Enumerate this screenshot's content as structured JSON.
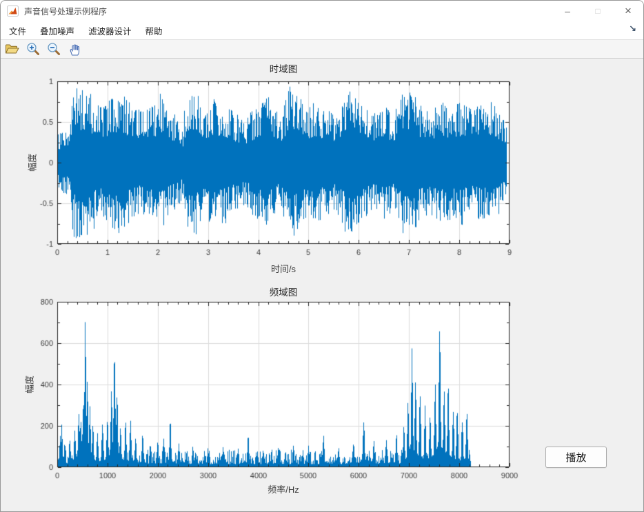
{
  "window": {
    "title": "声音信号处理示例程序",
    "controls": {
      "minimize": "–",
      "maximize": "□",
      "close": "×"
    }
  },
  "menu_bar": {
    "items": [
      {
        "label": "文件"
      },
      {
        "label": "叠加噪声"
      },
      {
        "label": "滤波器设计"
      },
      {
        "label": "帮助"
      }
    ],
    "dock_arrow": "↘"
  },
  "toolbar": {
    "icons": [
      "open-folder",
      "zoom-in",
      "zoom-out",
      "pan-hand"
    ]
  },
  "play_button": {
    "label": "播放"
  },
  "colors": {
    "accent_line": "#0072BD",
    "figure_bg": "#f0f0f0",
    "plot_bg": "#ffffff",
    "axes": "#262626",
    "grid": "#dcdcdc",
    "tick_text": "#3c3c3c"
  },
  "chart_data": [
    {
      "type": "line",
      "variant": "waveform",
      "title": "时域图",
      "xlabel": "时间/s",
      "ylabel": "幅度",
      "xlim": [
        0,
        9
      ],
      "ylim": [
        -1,
        1
      ],
      "xticks": [
        0,
        1,
        2,
        3,
        4,
        5,
        6,
        7,
        8,
        9
      ],
      "yticks": [
        -1,
        -0.5,
        0,
        0.5,
        1
      ],
      "xminor": 0.2,
      "yminor": 0.25,
      "grid": true,
      "legend": "none",
      "color": "#0072BD",
      "signal_end_s": 8.95,
      "envelope": [
        [
          0,
          0.35
        ],
        [
          0.25,
          0.4
        ],
        [
          0.32,
          0.92
        ],
        [
          0.5,
          0.95
        ],
        [
          0.7,
          0.85
        ],
        [
          0.9,
          0.7
        ],
        [
          1.1,
          0.8
        ],
        [
          1.25,
          0.9
        ],
        [
          1.5,
          0.7
        ],
        [
          1.7,
          0.65
        ],
        [
          1.9,
          0.7
        ],
        [
          2.05,
          0.85
        ],
        [
          2.2,
          0.7
        ],
        [
          2.35,
          0.6
        ],
        [
          2.5,
          0.45
        ],
        [
          2.58,
          0.95
        ],
        [
          2.75,
          0.9
        ],
        [
          2.95,
          0.7
        ],
        [
          3.15,
          0.8
        ],
        [
          3.35,
          0.75
        ],
        [
          3.55,
          0.6
        ],
        [
          3.75,
          0.55
        ],
        [
          3.95,
          0.7
        ],
        [
          4.15,
          0.85
        ],
        [
          4.3,
          0.75
        ],
        [
          4.45,
          0.5
        ],
        [
          4.6,
          0.95
        ],
        [
          4.75,
          0.9
        ],
        [
          4.95,
          0.7
        ],
        [
          5.15,
          0.75
        ],
        [
          5.35,
          0.65
        ],
        [
          5.55,
          0.6
        ],
        [
          5.75,
          0.9
        ],
        [
          5.9,
          0.85
        ],
        [
          6.1,
          0.7
        ],
        [
          6.3,
          0.6
        ],
        [
          6.5,
          0.7
        ],
        [
          6.7,
          0.6
        ],
        [
          6.9,
          0.92
        ],
        [
          7.05,
          0.88
        ],
        [
          7.25,
          0.7
        ],
        [
          7.45,
          0.65
        ],
        [
          7.65,
          0.75
        ],
        [
          7.85,
          0.7
        ],
        [
          8.05,
          0.78
        ],
        [
          8.25,
          0.65
        ],
        [
          8.45,
          0.72
        ],
        [
          8.65,
          0.75
        ],
        [
          8.85,
          0.6
        ],
        [
          8.95,
          0.45
        ]
      ]
    },
    {
      "type": "line",
      "variant": "spectrum",
      "title": "频域图",
      "xlabel": "频率/Hz",
      "ylabel": "幅度",
      "xlim": [
        0,
        9000
      ],
      "ylim": [
        0,
        800
      ],
      "xticks": [
        0,
        1000,
        2000,
        3000,
        4000,
        5000,
        6000,
        7000,
        8000,
        9000
      ],
      "yticks": [
        0,
        200,
        400,
        600,
        800
      ],
      "xminor": 200,
      "yminor": 100,
      "grid": true,
      "legend": "none",
      "color": "#0072BD",
      "cutoff_hz": 8230,
      "noise_floor": [
        15,
        85
      ],
      "peaks": [
        [
          60,
          160
        ],
        [
          90,
          215
        ],
        [
          150,
          120
        ],
        [
          250,
          150
        ],
        [
          350,
          190
        ],
        [
          430,
          300
        ],
        [
          470,
          260
        ],
        [
          520,
          350
        ],
        [
          560,
          735
        ],
        [
          600,
          430
        ],
        [
          650,
          300
        ],
        [
          710,
          210
        ],
        [
          800,
          180
        ],
        [
          900,
          230
        ],
        [
          1000,
          270
        ],
        [
          1080,
          420
        ],
        [
          1140,
          625
        ],
        [
          1190,
          400
        ],
        [
          1260,
          200
        ],
        [
          1360,
          230
        ],
        [
          1460,
          235
        ],
        [
          1560,
          150
        ],
        [
          1700,
          185
        ],
        [
          1850,
          120
        ],
        [
          2000,
          135
        ],
        [
          2120,
          150
        ],
        [
          2250,
          235
        ],
        [
          2420,
          120
        ],
        [
          2700,
          105
        ],
        [
          3000,
          95
        ],
        [
          3300,
          105
        ],
        [
          3600,
          100
        ],
        [
          3800,
          165
        ],
        [
          4100,
          95
        ],
        [
          4400,
          105
        ],
        [
          4700,
          115
        ],
        [
          5000,
          105
        ],
        [
          5300,
          160
        ],
        [
          5600,
          105
        ],
        [
          5900,
          125
        ],
        [
          6100,
          255
        ],
        [
          6300,
          135
        ],
        [
          6550,
          145
        ],
        [
          6750,
          175
        ],
        [
          6900,
          210
        ],
        [
          6980,
          320
        ],
        [
          7060,
          625
        ],
        [
          7130,
          450
        ],
        [
          7220,
          380
        ],
        [
          7320,
          310
        ],
        [
          7420,
          290
        ],
        [
          7520,
          430
        ],
        [
          7610,
          735
        ],
        [
          7700,
          410
        ],
        [
          7780,
          430
        ],
        [
          7880,
          310
        ],
        [
          7960,
          300
        ],
        [
          8060,
          250
        ],
        [
          8150,
          300
        ]
      ]
    }
  ]
}
